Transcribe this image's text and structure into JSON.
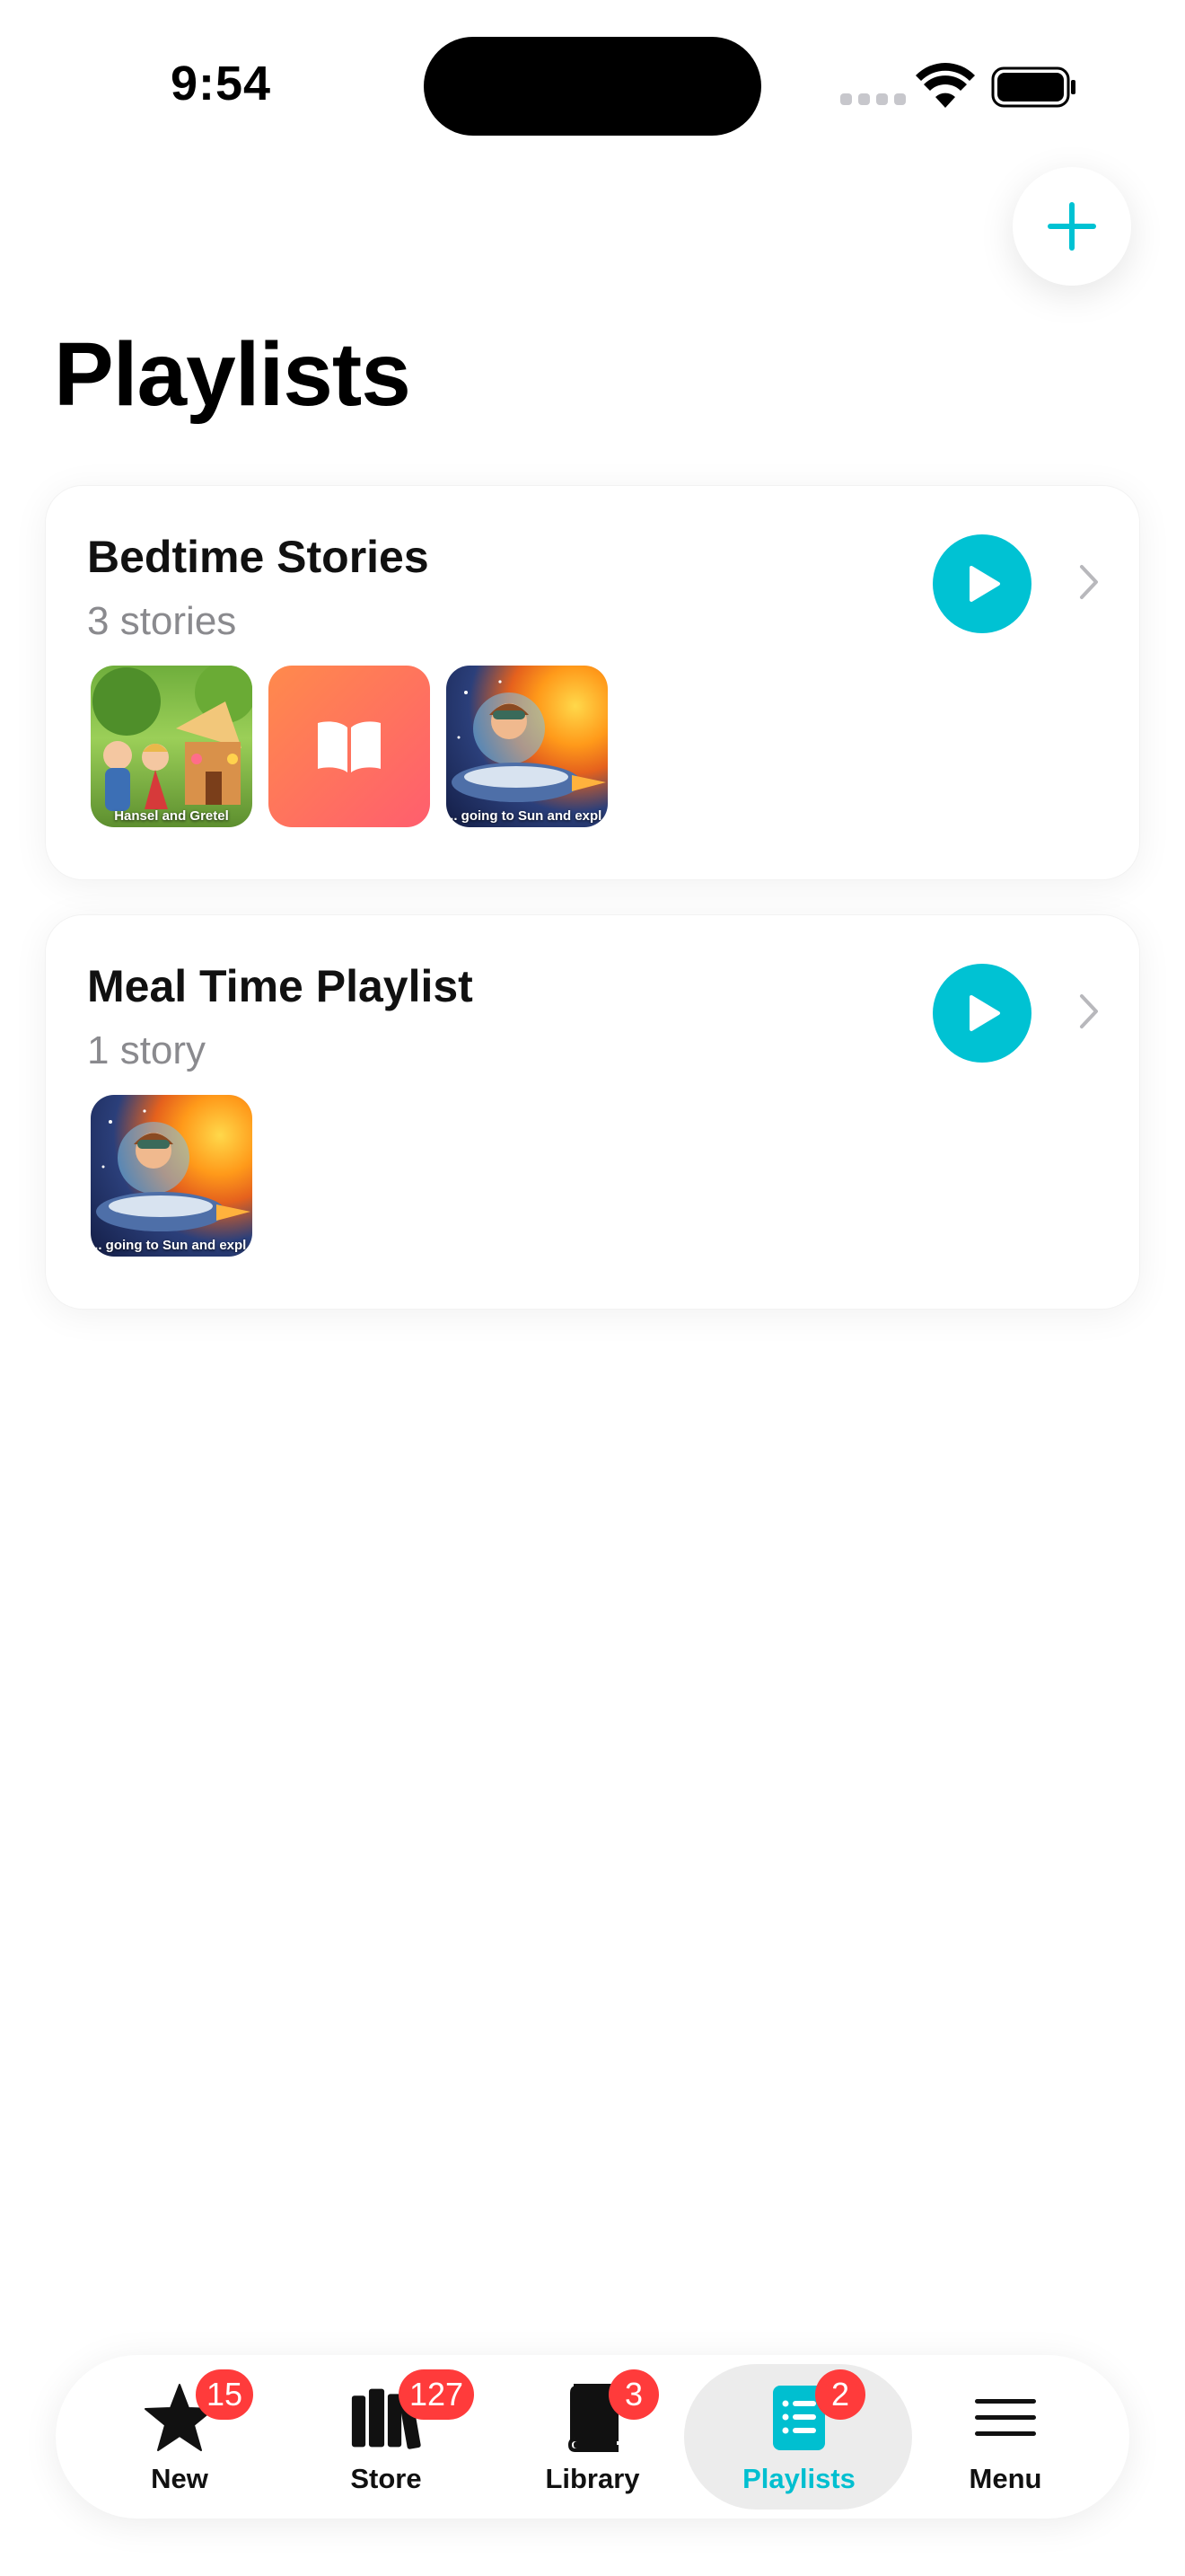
{
  "status_bar": {
    "time": "9:54"
  },
  "header": {
    "title": "Playlists",
    "add_icon": "plus-icon"
  },
  "playlists": [
    {
      "title": "Bedtime Stories",
      "count": "3 stories",
      "thumbnails": [
        {
          "type": "image",
          "caption": "Hansel and Gretel"
        },
        {
          "type": "placeholder",
          "icon": "book-icon"
        },
        {
          "type": "image",
          "caption": "... going to Sun and expl..."
        }
      ]
    },
    {
      "title": "Meal Time Playlist",
      "count": "1 story",
      "thumbnails": [
        {
          "type": "image",
          "caption": "... going to Sun and expl..."
        }
      ]
    }
  ],
  "tabs": [
    {
      "label": "New",
      "badge": "15",
      "icon": "star-icon"
    },
    {
      "label": "Store",
      "badge": "127",
      "icon": "books-icon"
    },
    {
      "label": "Library",
      "badge": "3",
      "icon": "book-icon"
    },
    {
      "label": "Playlists",
      "badge": "2",
      "icon": "list-icon",
      "active": true
    },
    {
      "label": "Menu",
      "icon": "menu-icon"
    }
  ],
  "colors": {
    "accent": "#00c2d3",
    "badge": "#ff3b3b",
    "muted": "#8a8a8e"
  }
}
